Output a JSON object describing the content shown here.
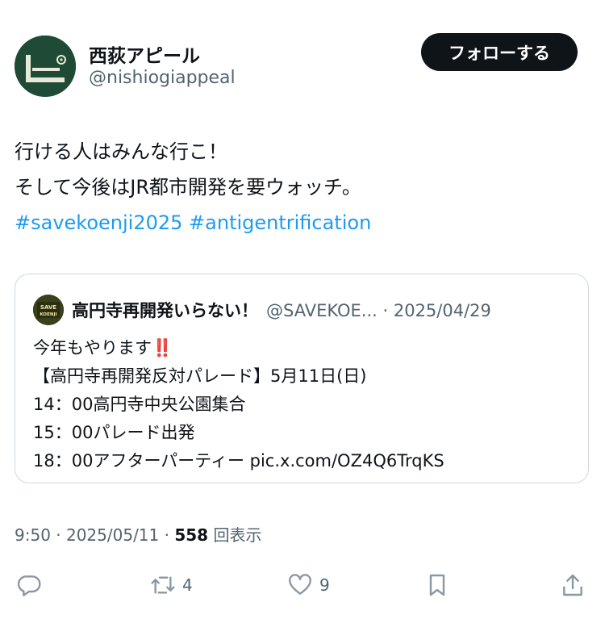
{
  "author": {
    "display_name": "西荻アピール",
    "handle": "@nishiogiappeal",
    "avatar_icon": "logo-icon",
    "avatar_color": "#1e4a36"
  },
  "follow_button": {
    "label": "フォローする"
  },
  "tweet": {
    "line1": "行ける人はみんな行こ！",
    "line2": "そして今後はJR都市開発を要ウォッチ。",
    "hashtags": [
      "#savekoenji2025",
      "#antigentrification"
    ]
  },
  "quote": {
    "avatar_text_top": "SAVE",
    "avatar_text_bottom": "KOENJI",
    "display_name": "高円寺再開発いらない！",
    "meta": "@SAVEKOE... · 2025/04/29",
    "line1": "今年もやります",
    "emoji": "‼️",
    "line2": "【高円寺再開発反対パレード】5月11日(日)",
    "line3": "14：00高円寺中央公園集合",
    "line4": "15：00パレード出発",
    "line5": "18：00アフターパーティー pic.x.com/OZ4Q6TrqKS"
  },
  "meta": {
    "time_date": "9:50 · 2025/05/11 · ",
    "views_count": "558",
    "views_label": " 回表示"
  },
  "actions": {
    "reply_count": "",
    "retweet_count": "4",
    "like_count": "9"
  },
  "colors": {
    "link": "#1d9bf0",
    "secondary_text": "#536471",
    "follow_bg": "#0f1419",
    "border": "#cfd9de"
  }
}
